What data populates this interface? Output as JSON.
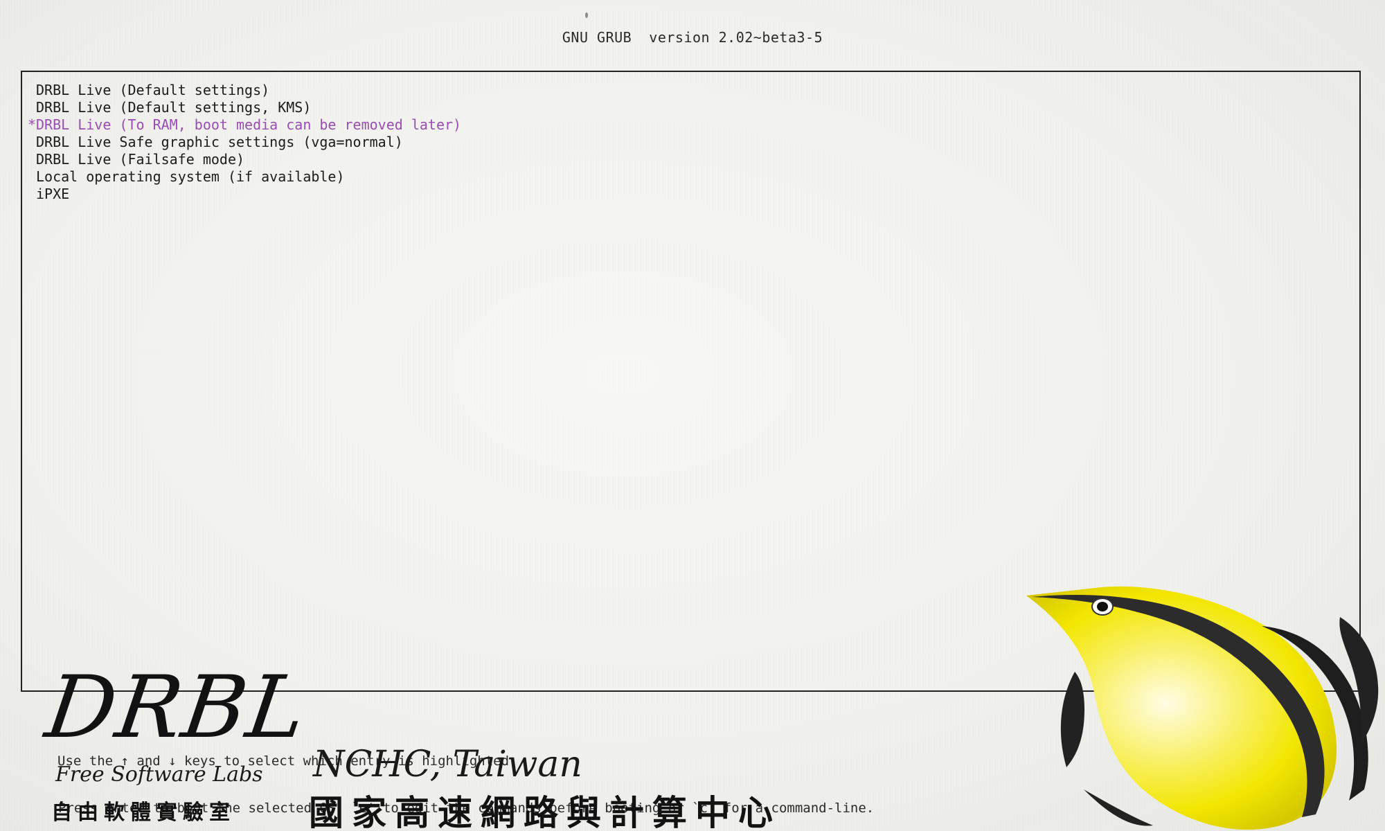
{
  "header": {
    "title": "GNU GRUB  version 2.02~beta3-5"
  },
  "menu": {
    "selected_marker": "*",
    "items": [
      {
        "label": "DRBL Live (Default settings)",
        "selected": false
      },
      {
        "label": "DRBL Live (Default settings, KMS)",
        "selected": false
      },
      {
        "label": "DRBL Live (To RAM, boot media can be removed later)",
        "selected": true
      },
      {
        "label": "DRBL Live Safe graphic settings (vga=normal)",
        "selected": false
      },
      {
        "label": "DRBL Live (Failsafe mode)",
        "selected": false
      },
      {
        "label": "Local operating system (if available)",
        "selected": false
      },
      {
        "label": "iPXE",
        "selected": false
      }
    ]
  },
  "help": {
    "line1": "Use the ↑ and ↓ keys to select which entry is highlighted.",
    "line2": "Press enter to boot the selected OS, `e' to edit the commands before booting or `c' for a command-line."
  },
  "branding": {
    "drbl_logo": "DRBL",
    "fsl_label": "Free Software Labs",
    "fsl_chinese": "自由軟體實驗室",
    "nchc_label": "NCHC, Taiwan",
    "nchc_chinese": "國家高速網路與計算中心"
  },
  "colors": {
    "background": "#f2f2ef",
    "text": "#1c1c1c",
    "selected_text": "#9b4cb4",
    "fish_yellow": "#f3e600",
    "fish_black": "#111111"
  },
  "icons": {
    "fish": "butterflyfish-mascot"
  }
}
